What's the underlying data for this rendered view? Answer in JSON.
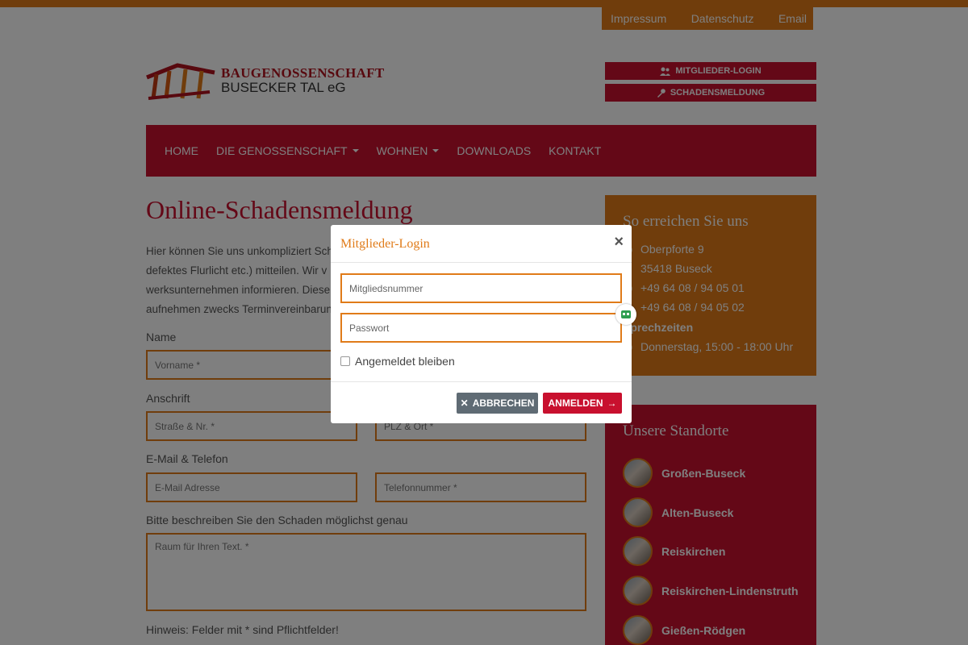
{
  "top_links": [
    "Impressum",
    "Datenschutz",
    "Email"
  ],
  "logo": {
    "line1": "BAUGENOSSENSCHAFT",
    "line2": "BUSECKER TAL eG"
  },
  "side_buttons": {
    "login": "MITGLIEDER-LOGIN",
    "damage": "SCHADENSMELDUNG"
  },
  "nav": {
    "items": [
      "HOME",
      "DIE GENOSSENSCHAFT",
      "WOHNEN",
      "DOWNLOADS",
      "KONTAKT"
    ]
  },
  "main": {
    "title": "Online-Schadensmeldung",
    "intro_lines": [
      "Hier können Sie uns unkompliziert Sch",
      "defektes Flurlicht etc.) mitteilen. Wir v",
      "werksunternehmen informieren. Diese",
      "aufnehmen zwecks Terminvereinbarun"
    ],
    "label_name": "Name",
    "label_address": "Anschrift",
    "label_contact": "E-Mail & Telefon",
    "label_describe": "Bitte beschreiben Sie den Schaden möglichst genau",
    "placeholders": {
      "firstname": "Vorname *",
      "street": "Straße & Nr. *",
      "zip": "PLZ & Ort *",
      "email": "E-Mail Adresse",
      "phone": "Telefonnummer *",
      "text": "Raum für Ihren Text. *"
    },
    "hint": "Hinweis: Felder mit * sind Pflichtfelder!"
  },
  "contact_box": {
    "title": "So erreichen Sie uns",
    "address1": "Oberpforte 9",
    "address2": "35418 Buseck",
    "phone": "+49 64 08 / 94 05 01",
    "fax": "+49 64 08 / 94 05 02",
    "hours_title": "Sprechzeiten",
    "hours": "Donnerstag, 15:00 - 18:00 Uhr"
  },
  "locations_box": {
    "title": "Unsere Standorte",
    "items": [
      "Großen-Buseck",
      "Alten-Buseck",
      "Reiskirchen",
      "Reiskirchen-Lindenstruth",
      "Gießen-Rödgen"
    ]
  },
  "modal": {
    "title": "Mitglieder-Login",
    "close": "×",
    "member_placeholder": "Mitgliedsnummer",
    "password_placeholder": "Passwort",
    "remember": "Angemeldet bleiben",
    "cancel": "ABBRECHEN",
    "submit": "ANMELDEN"
  },
  "colors": {
    "brand_red": "#c8102e",
    "brand_orange": "#e07b19",
    "cancel_gray": "#5f6b74"
  }
}
